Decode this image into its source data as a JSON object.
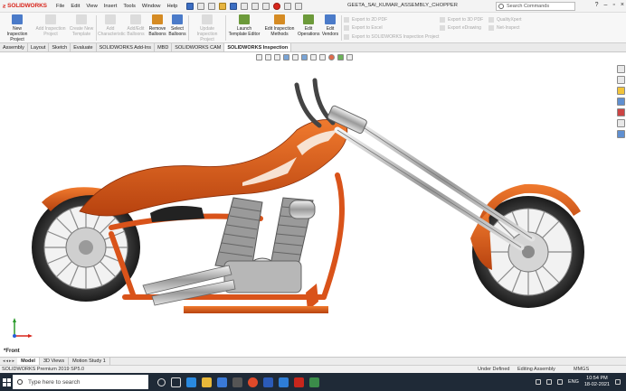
{
  "app": {
    "brand": "SOLIDWORKS",
    "document_title": "GEETA_SAI_KUMAR_ASSEMBLY_CHOPPER",
    "menus": [
      "File",
      "Edit",
      "View",
      "Insert",
      "Tools",
      "Window",
      "Help"
    ],
    "search_placeholder": "Search Commands"
  },
  "ribbon": {
    "new_project": "New Inspection Project",
    "add_project": "Add Inspection Project",
    "create_template": "Create New Template",
    "add_characteristic": "Add Characteristic",
    "add_edit_balloons": "Add/Edit Balloons",
    "remove_balloons": "Remove Balloons",
    "select_balloons": "Select Balloons",
    "update_project": "Update Inspection Project",
    "launch_template_editor": "Launch Template Editor",
    "edit_methods": "Edit Inspection Methods",
    "edit_operations": "Edit Operations",
    "edit_vendors": "Edit Vendors",
    "export_2d_pdf": "Export to 2D PDF",
    "export_excel": "Export to Excel",
    "export_sw_inspection": "Export to SOLIDWORKS Inspection Project",
    "export_3d_pdf": "Export to 3D PDF",
    "export_edrawing": "Export eDrawing",
    "quality_xpert": "QualityXpert",
    "net_inspect": "Net-Inspect"
  },
  "tabs": [
    "Assembly",
    "Layout",
    "Sketch",
    "Evaluate",
    "SOLIDWORKS Add-Ins",
    "MBD",
    "SOLIDWORKS CAM",
    "SOLIDWORKS Inspection"
  ],
  "active_tab": "SOLIDWORKS Inspection",
  "viewport": {
    "view_label": "*Front"
  },
  "model_tabs": [
    "Model",
    "3D Views",
    "Motion Study 1"
  ],
  "status": {
    "product": "SOLIDWORKS Premium 2019 SP5.0",
    "state": "Under Defined",
    "mode": "Editing Assembly",
    "units": "MMGS"
  },
  "taskbar": {
    "search_placeholder": "Type here to search",
    "language": "ENG",
    "time": "10:54 PM",
    "date": "18-02-2021"
  },
  "colors": {
    "brand_red": "#d8261c",
    "bike_orange": "#d9531a",
    "taskbar": "#1f2a37"
  }
}
